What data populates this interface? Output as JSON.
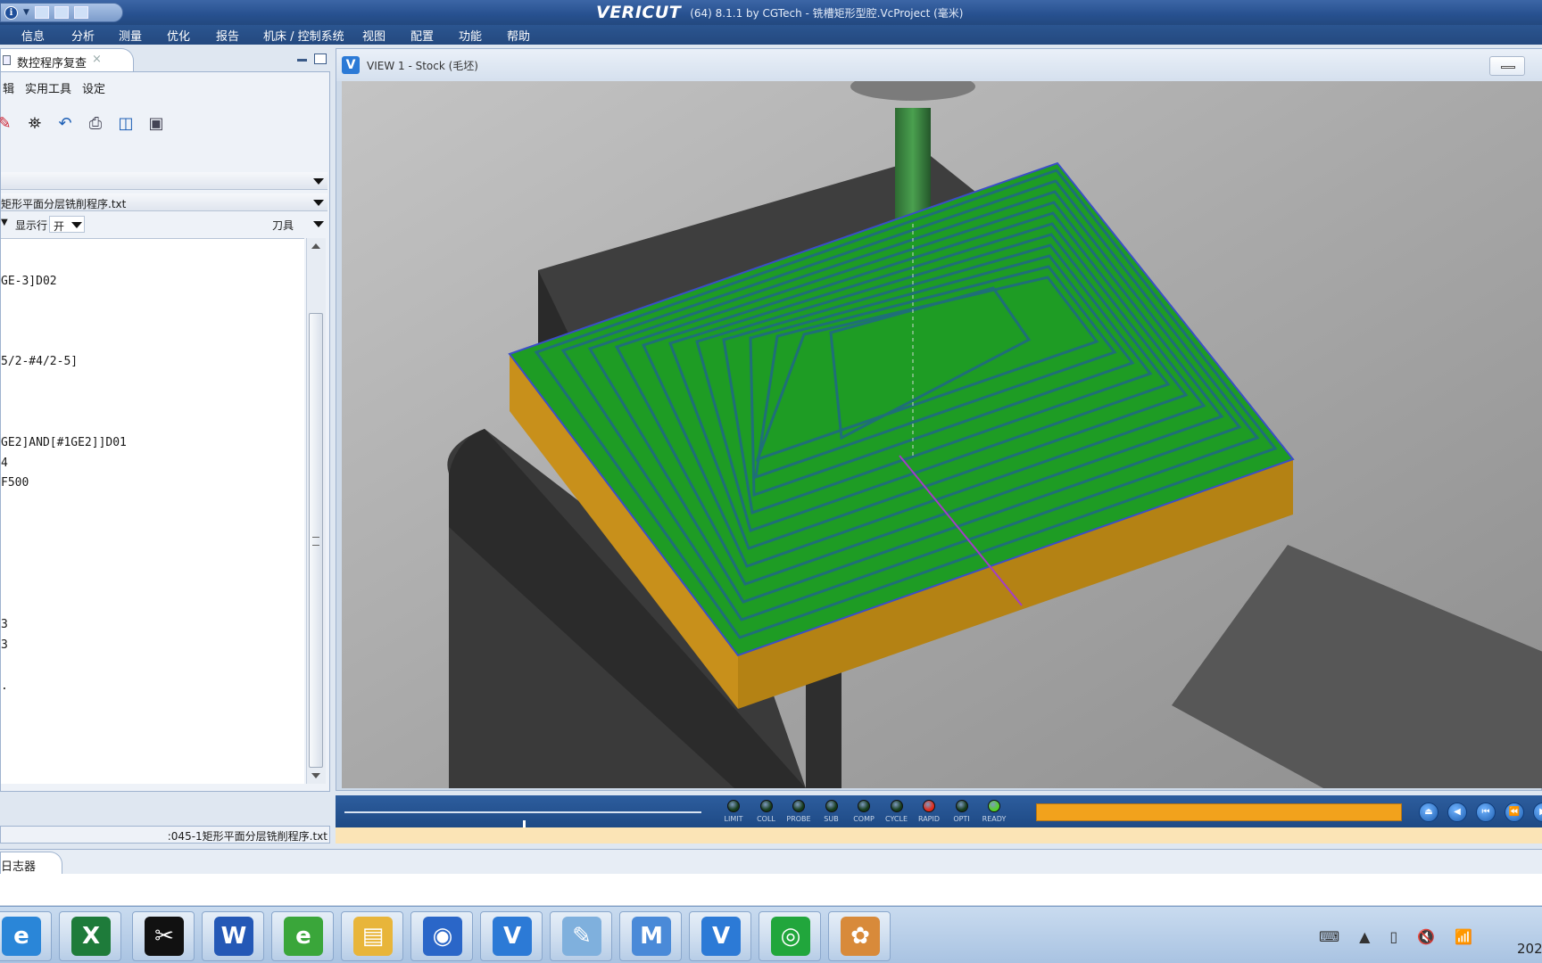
{
  "titlebar": {
    "brand": "VERICUT",
    "rest": "(64)  8.1.1 by CGTech - 铣槽矩形型腔.VcProject (毫米)",
    "info_icon": "i"
  },
  "menu": [
    "信息",
    "分析",
    "测量",
    "优化",
    "报告",
    "机床 / 控制系统",
    "视图",
    "配置",
    "功能",
    "帮助"
  ],
  "left_panel": {
    "tab_label": "数控程序复查",
    "tab_close": "×",
    "menus": [
      "辑",
      "实用工具",
      "设定"
    ],
    "toolbar_icons": [
      "edit-icon",
      "binoculars-icon",
      "undo-icon",
      "print-icon",
      "split-view-icon",
      "window-icon"
    ],
    "toolbar_glyphs": [
      "✎",
      "⛯",
      "↶",
      "⎙",
      "◫",
      "▣"
    ],
    "dropdown1": "",
    "dropdown2": "矩形平面分层铣削程序.txt",
    "filter_arrow": "▼",
    "filter_label": "显示行",
    "filter_value": "开",
    "tool_label": "刀具",
    "code_lines": [
      {
        "text": "GE-3]D02"
      },
      {
        "text": "5/2-#4/2-5]"
      },
      {
        "text": "GE2]AND[#1GE2]]D01"
      },
      {
        "text": "4"
      },
      {
        "text": "F500"
      },
      {
        "text": "3"
      },
      {
        "text": "3"
      },
      {
        "text": "."
      }
    ],
    "status_path": ":045-1矩形平面分层铣削程序.txt"
  },
  "view": {
    "logo": "V",
    "title": "VIEW 1 - Stock (毛坯)"
  },
  "leds": [
    {
      "label": "LIMIT",
      "color": "#153a1a"
    },
    {
      "label": "COLL",
      "color": "#153a1a"
    },
    {
      "label": "PROBE",
      "color": "#153a1a"
    },
    {
      "label": "SUB",
      "color": "#153a1a"
    },
    {
      "label": "COMP",
      "color": "#153a1a"
    },
    {
      "label": "CYCLE",
      "color": "#153a1a"
    },
    {
      "label": "RAPID",
      "color": "#e22a1a"
    },
    {
      "label": "OPTI",
      "color": "#153a1a"
    },
    {
      "label": "READY",
      "color": "#55d22a"
    }
  ],
  "playback_buttons": [
    {
      "name": "eject-button",
      "glyph": "⏏"
    },
    {
      "name": "step-back-button",
      "glyph": "◀"
    },
    {
      "name": "rewind-start-button",
      "glyph": "⏮"
    },
    {
      "name": "fast-back-button",
      "glyph": "⏪"
    },
    {
      "name": "more-button",
      "glyph": "▶"
    }
  ],
  "progress": 1.0,
  "slider_position": 0.5,
  "log_tab": "日志器",
  "taskbar": [
    {
      "name": "ie-icon",
      "glyph": "e",
      "color": "#2a86d8"
    },
    {
      "name": "excel-icon",
      "glyph": "X",
      "color": "#1e7b3a"
    },
    {
      "name": "capcut-icon",
      "glyph": "✂",
      "color": "#111111"
    },
    {
      "name": "word-icon",
      "glyph": "W",
      "color": "#2458b6"
    },
    {
      "name": "browser-icon",
      "glyph": "e",
      "color": "#3aa63a"
    },
    {
      "name": "folder-icon",
      "glyph": "▤",
      "color": "#e8b53a"
    },
    {
      "name": "globe-icon",
      "glyph": "◉",
      "color": "#2a66c8"
    },
    {
      "name": "vericut-icon",
      "glyph": "V",
      "color": "#2c7ad6"
    },
    {
      "name": "notepad-icon",
      "glyph": "✎",
      "color": "#7fb0dd"
    },
    {
      "name": "search-tool-icon",
      "glyph": "M",
      "color": "#4a8ad8"
    },
    {
      "name": "vericut-icon-2",
      "glyph": "V",
      "color": "#2c7ad6"
    },
    {
      "name": "wechat-icon",
      "glyph": "◎",
      "color": "#21a63c"
    },
    {
      "name": "paint-icon",
      "glyph": "✿",
      "color": "#d88a3a"
    }
  ],
  "tray_glyphs": [
    "⌨",
    "▲",
    "▯",
    "🔇",
    "📶"
  ],
  "clock": "202"
}
